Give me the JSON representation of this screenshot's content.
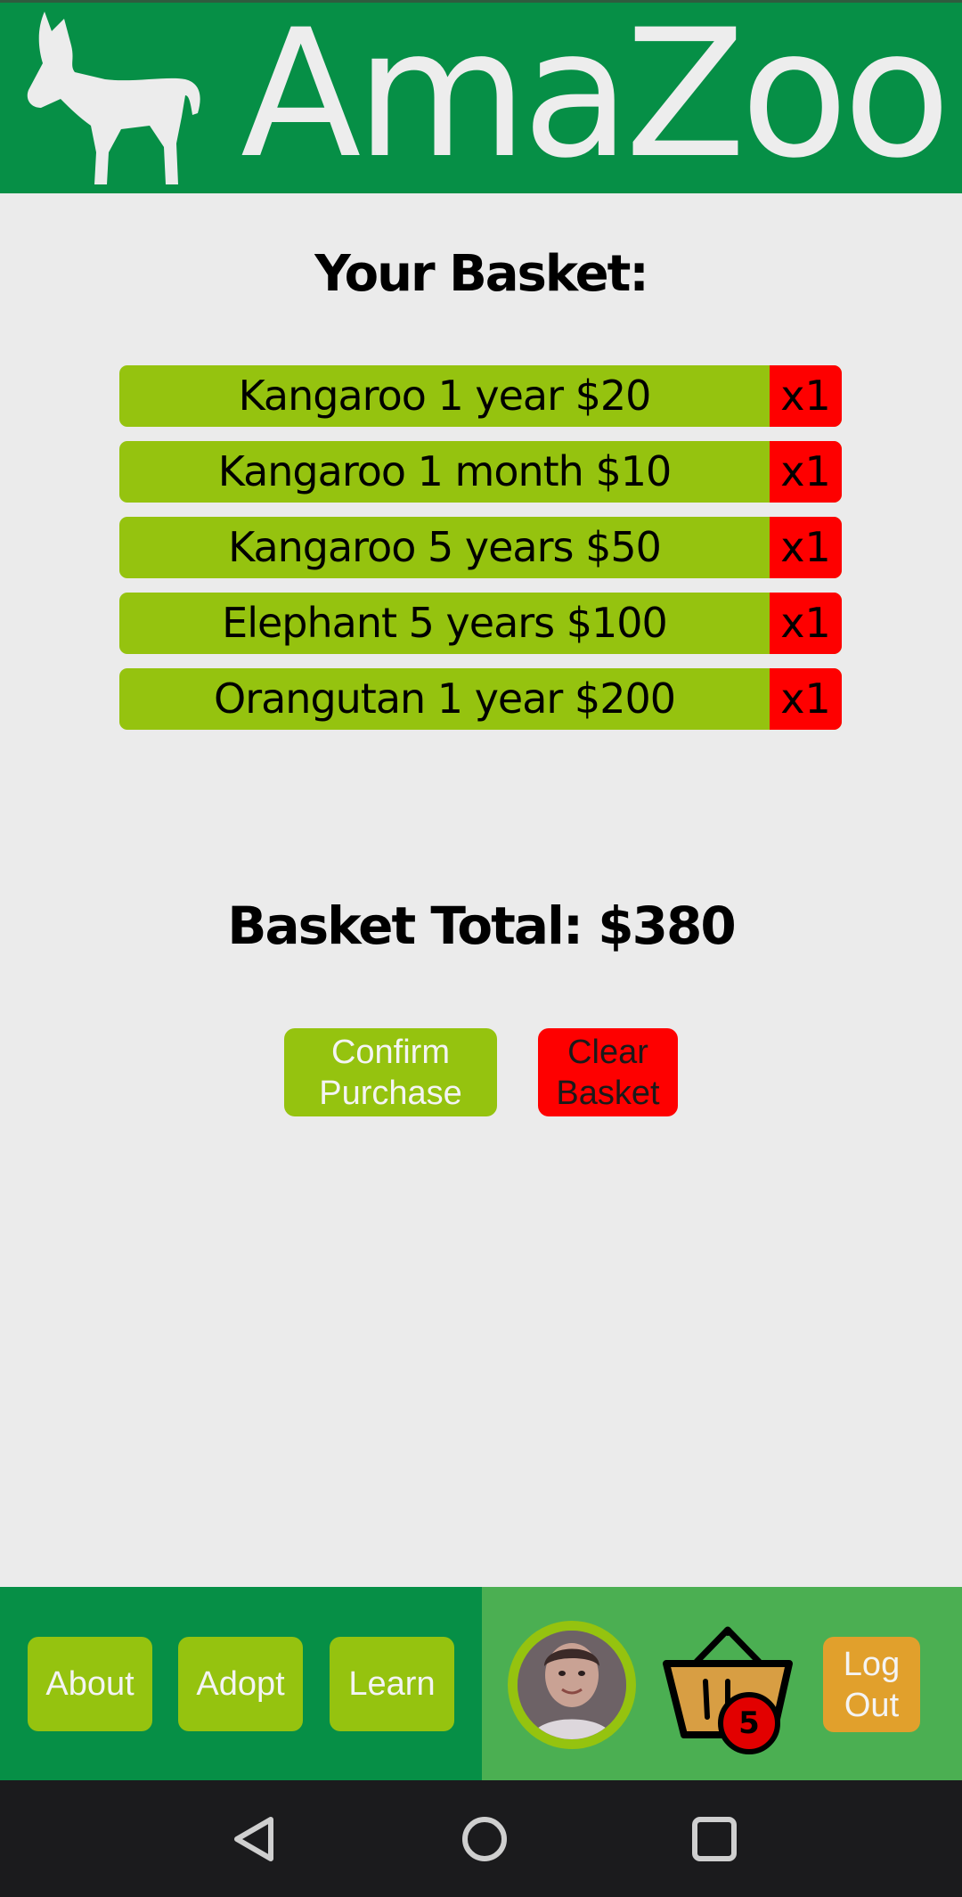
{
  "header": {
    "brand": "AmaZoo",
    "logo_icon": "donkey-logo-icon"
  },
  "basket": {
    "heading": "Your Basket:",
    "items": [
      {
        "label": "Kangaroo 1 year $20",
        "qty": "x1"
      },
      {
        "label": "Kangaroo 1 month $10",
        "qty": "x1"
      },
      {
        "label": "Kangaroo 5 years $50",
        "qty": "x1"
      },
      {
        "label": "Elephant 5 years $100",
        "qty": "x1"
      },
      {
        "label": "Orangutan 1 year $200",
        "qty": "x1"
      }
    ],
    "total": "Basket Total: $380",
    "confirm_label": "Confirm\nPurchase",
    "clear_label": "Clear\nBasket"
  },
  "nav": {
    "about": "About",
    "adopt": "Adopt",
    "learn": "Learn",
    "basket_count": "5",
    "logout": "Log\nOut"
  },
  "colors": {
    "header_green": "#068f46",
    "lime": "#95c30f",
    "red": "#fe0000",
    "nav_right_green": "#4baf52",
    "logout_orange": "#e1a02c"
  }
}
